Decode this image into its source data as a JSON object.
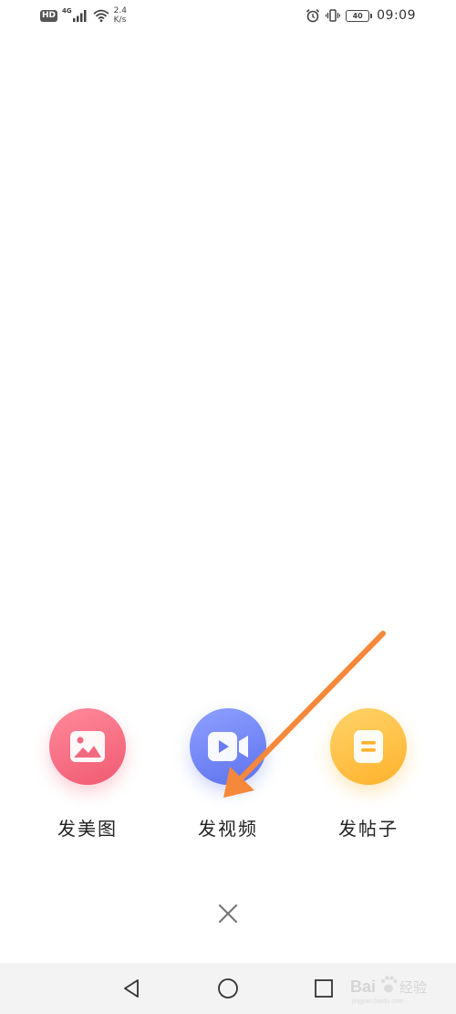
{
  "status_bar": {
    "hd_badge": "HD",
    "network_type": "4G",
    "speed_value": "2.4",
    "speed_unit": "K/s",
    "battery_level": "40",
    "time": "09:09",
    "icons": [
      "signal-icon",
      "wifi-icon",
      "alarm-icon",
      "vibrate-icon",
      "battery-icon"
    ]
  },
  "actions": [
    {
      "label": "发美图",
      "icon": "image-icon",
      "color": "#f05a72"
    },
    {
      "label": "发视频",
      "icon": "video-camera-icon",
      "color": "#5e72ee"
    },
    {
      "label": "发帖子",
      "icon": "document-icon",
      "color": "#ffb22c"
    }
  ],
  "close": {
    "icon": "close-icon"
  },
  "nav_bar": {
    "icons": [
      "back-icon",
      "home-icon",
      "recents-icon"
    ]
  },
  "annotation": {
    "type": "arrow",
    "color": "#f5883a",
    "target": "发视频"
  },
  "watermark": {
    "text": "Bai 经验",
    "subtext": "jingyan.baidu.com"
  }
}
